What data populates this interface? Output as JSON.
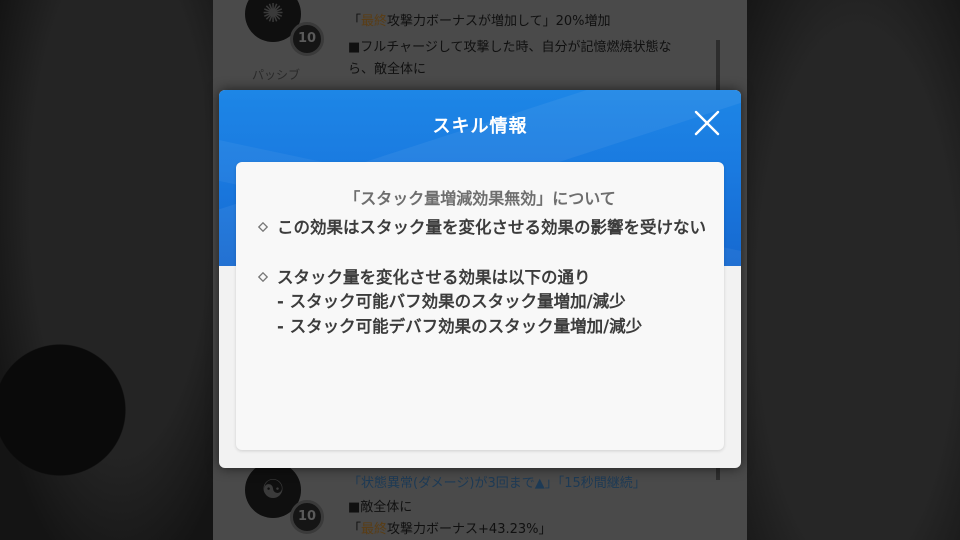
{
  "background": {
    "passive_label": "パッシブ",
    "skill_level_top": "10",
    "skill_level_bottom": "10",
    "lines_top": [
      {
        "prefix": "「",
        "highlight": "最終",
        "text": "攻撃力ボーナスが増加して」20%増加"
      },
      {
        "prefix": "",
        "highlight": "",
        "text": "■フルチャージして攻撃した時、自分が記憶燃焼状態な"
      },
      {
        "prefix": "",
        "highlight": "",
        "text": "ら、敵全体に"
      }
    ],
    "lines_bottom": [
      {
        "prefix": "",
        "highlight": "",
        "text": "「状態異常(ダメージ)が3回まで▲」「15秒間継続」"
      },
      {
        "prefix": "",
        "highlight": "",
        "text": "■敵全体に"
      },
      {
        "prefix": "「",
        "highlight": "最終",
        "text": "攻撃力ボーナス+43.23%」"
      }
    ]
  },
  "modal": {
    "title": "スキル情報",
    "close_icon": "close-x-icon",
    "card_title": "「スタック量増減効果無効」について",
    "bullets": [
      {
        "icon": "diamond-bullet-icon",
        "text": "この効果はスタック量を変化させる効果の影響を受けない"
      },
      {
        "icon": "diamond-bullet-icon",
        "text": "スタック量を変化させる効果は以下の通り"
      }
    ],
    "sub_items": [
      "- スタック可能バフ効果のスタック量増加/減少",
      "- スタック可能デバフ効果のスタック量増加/減少"
    ]
  },
  "colors": {
    "header_blue": "#1a7ae0",
    "card_bg": "#f8f8f8",
    "text": "#3c3c3c",
    "card_title": "#6e6e6e"
  }
}
